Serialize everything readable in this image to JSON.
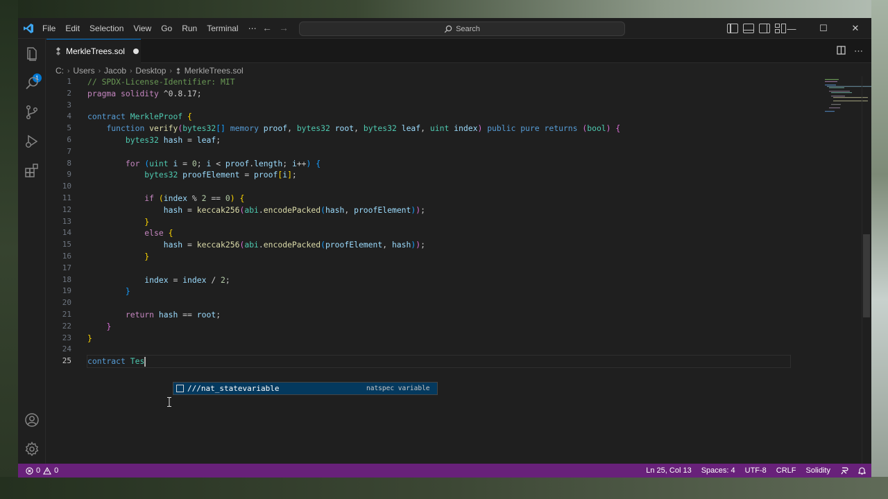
{
  "window": {
    "menu": [
      "File",
      "Edit",
      "Selection",
      "View",
      "Go",
      "Run",
      "Terminal",
      "⋯"
    ],
    "search_placeholder": "Search",
    "nav_back": "←",
    "nav_forward": "→",
    "controls": {
      "minimize": "—",
      "maximize": "☐",
      "close": "✕"
    }
  },
  "activity_bar": {
    "icons": [
      "explorer-icon",
      "search-icon",
      "source-control-icon",
      "run-debug-icon",
      "extensions-icon",
      "account-icon",
      "manage-gear-icon"
    ],
    "explorer_badge": "1"
  },
  "tab": {
    "label": "MerkleTrees.sol",
    "modified": true
  },
  "breadcrumb": [
    "C:",
    "Users",
    "Jacob",
    "Desktop",
    "MerkleTrees.sol"
  ],
  "editor": {
    "line_numbers": [
      "1",
      "2",
      "3",
      "4",
      "5",
      "6",
      "7",
      "8",
      "9",
      "10",
      "11",
      "12",
      "13",
      "14",
      "15",
      "16",
      "17",
      "18",
      "19",
      "20",
      "21",
      "22",
      "23",
      "24",
      "25"
    ],
    "active_line": "25",
    "lines": [
      [
        {
          "c": "cm",
          "t": "// SPDX-License-Identifier: MIT"
        }
      ],
      [
        {
          "c": "k",
          "t": "pragma"
        },
        {
          "c": "",
          "t": " "
        },
        {
          "c": "k",
          "t": "solidity"
        },
        {
          "c": "",
          "t": " ^0.8.17;"
        }
      ],
      [],
      [
        {
          "c": "kb",
          "t": "contract"
        },
        {
          "c": "",
          "t": " "
        },
        {
          "c": "t",
          "t": "MerkleProof"
        },
        {
          "c": "",
          "t": " "
        },
        {
          "c": "by",
          "t": "{"
        }
      ],
      [
        {
          "c": "",
          "t": "    "
        },
        {
          "c": "kb",
          "t": "function"
        },
        {
          "c": "",
          "t": " "
        },
        {
          "c": "fn",
          "t": "verify"
        },
        {
          "c": "bp",
          "t": "("
        },
        {
          "c": "t",
          "t": "bytes32"
        },
        {
          "c": "bb",
          "t": "[]"
        },
        {
          "c": "",
          "t": " "
        },
        {
          "c": "kb",
          "t": "memory"
        },
        {
          "c": "",
          "t": " "
        },
        {
          "c": "v",
          "t": "proof"
        },
        {
          "c": "",
          "t": ", "
        },
        {
          "c": "t",
          "t": "bytes32"
        },
        {
          "c": "",
          "t": " "
        },
        {
          "c": "v",
          "t": "root"
        },
        {
          "c": "",
          "t": ", "
        },
        {
          "c": "t",
          "t": "bytes32"
        },
        {
          "c": "",
          "t": " "
        },
        {
          "c": "v",
          "t": "leaf"
        },
        {
          "c": "",
          "t": ", "
        },
        {
          "c": "t",
          "t": "uint"
        },
        {
          "c": "",
          "t": " "
        },
        {
          "c": "v",
          "t": "index"
        },
        {
          "c": "bp",
          "t": ")"
        },
        {
          "c": "",
          "t": " "
        },
        {
          "c": "kb",
          "t": "public"
        },
        {
          "c": "",
          "t": " "
        },
        {
          "c": "kb",
          "t": "pure"
        },
        {
          "c": "",
          "t": " "
        },
        {
          "c": "kb",
          "t": "returns"
        },
        {
          "c": "",
          "t": " "
        },
        {
          "c": "bp",
          "t": "("
        },
        {
          "c": "t",
          "t": "bool"
        },
        {
          "c": "bp",
          "t": ")"
        },
        {
          "c": "",
          "t": " "
        },
        {
          "c": "bp",
          "t": "{"
        }
      ],
      [
        {
          "c": "",
          "t": "        "
        },
        {
          "c": "t",
          "t": "bytes32"
        },
        {
          "c": "",
          "t": " "
        },
        {
          "c": "v",
          "t": "hash"
        },
        {
          "c": "",
          "t": " = "
        },
        {
          "c": "v",
          "t": "leaf"
        },
        {
          "c": "",
          "t": ";"
        }
      ],
      [],
      [
        {
          "c": "",
          "t": "        "
        },
        {
          "c": "k",
          "t": "for"
        },
        {
          "c": "",
          "t": " "
        },
        {
          "c": "bb",
          "t": "("
        },
        {
          "c": "t",
          "t": "uint"
        },
        {
          "c": "",
          "t": " "
        },
        {
          "c": "v",
          "t": "i"
        },
        {
          "c": "",
          "t": " = "
        },
        {
          "c": "num",
          "t": "0"
        },
        {
          "c": "",
          "t": "; "
        },
        {
          "c": "v",
          "t": "i"
        },
        {
          "c": "",
          "t": " < "
        },
        {
          "c": "v",
          "t": "proof"
        },
        {
          "c": "",
          "t": "."
        },
        {
          "c": "v",
          "t": "length"
        },
        {
          "c": "",
          "t": "; "
        },
        {
          "c": "v",
          "t": "i"
        },
        {
          "c": "",
          "t": "++"
        },
        {
          "c": "bb",
          "t": ")"
        },
        {
          "c": "",
          "t": " "
        },
        {
          "c": "bb",
          "t": "{"
        }
      ],
      [
        {
          "c": "",
          "t": "            "
        },
        {
          "c": "t",
          "t": "bytes32"
        },
        {
          "c": "",
          "t": " "
        },
        {
          "c": "v",
          "t": "proofElement"
        },
        {
          "c": "",
          "t": " = "
        },
        {
          "c": "v",
          "t": "proof"
        },
        {
          "c": "by",
          "t": "["
        },
        {
          "c": "v",
          "t": "i"
        },
        {
          "c": "by",
          "t": "]"
        },
        {
          "c": "",
          "t": ";"
        }
      ],
      [],
      [
        {
          "c": "",
          "t": "            "
        },
        {
          "c": "k",
          "t": "if"
        },
        {
          "c": "",
          "t": " "
        },
        {
          "c": "by",
          "t": "("
        },
        {
          "c": "v",
          "t": "index"
        },
        {
          "c": "",
          "t": " % "
        },
        {
          "c": "num",
          "t": "2"
        },
        {
          "c": "",
          "t": " == "
        },
        {
          "c": "num",
          "t": "0"
        },
        {
          "c": "by",
          "t": ")"
        },
        {
          "c": "",
          "t": " "
        },
        {
          "c": "by",
          "t": "{"
        }
      ],
      [
        {
          "c": "",
          "t": "                "
        },
        {
          "c": "v",
          "t": "hash"
        },
        {
          "c": "",
          "t": " = "
        },
        {
          "c": "fn",
          "t": "keccak256"
        },
        {
          "c": "bp",
          "t": "("
        },
        {
          "c": "t",
          "t": "abi"
        },
        {
          "c": "",
          "t": "."
        },
        {
          "c": "fn",
          "t": "encodePacked"
        },
        {
          "c": "bb",
          "t": "("
        },
        {
          "c": "v",
          "t": "hash"
        },
        {
          "c": "",
          "t": ", "
        },
        {
          "c": "v",
          "t": "proofElement"
        },
        {
          "c": "bb",
          "t": ")"
        },
        {
          "c": "bp",
          "t": ")"
        },
        {
          "c": "",
          "t": ";"
        }
      ],
      [
        {
          "c": "",
          "t": "            "
        },
        {
          "c": "by",
          "t": "}"
        }
      ],
      [
        {
          "c": "",
          "t": "            "
        },
        {
          "c": "k",
          "t": "else"
        },
        {
          "c": "",
          "t": " "
        },
        {
          "c": "by",
          "t": "{"
        }
      ],
      [
        {
          "c": "",
          "t": "                "
        },
        {
          "c": "v",
          "t": "hash"
        },
        {
          "c": "",
          "t": " = "
        },
        {
          "c": "fn",
          "t": "keccak256"
        },
        {
          "c": "bp",
          "t": "("
        },
        {
          "c": "t",
          "t": "abi"
        },
        {
          "c": "",
          "t": "."
        },
        {
          "c": "fn",
          "t": "encodePacked"
        },
        {
          "c": "bb",
          "t": "("
        },
        {
          "c": "v",
          "t": "proofElement"
        },
        {
          "c": "",
          "t": ", "
        },
        {
          "c": "v",
          "t": "hash"
        },
        {
          "c": "bb",
          "t": ")"
        },
        {
          "c": "bp",
          "t": ")"
        },
        {
          "c": "",
          "t": ";"
        }
      ],
      [
        {
          "c": "",
          "t": "            "
        },
        {
          "c": "by",
          "t": "}"
        }
      ],
      [],
      [
        {
          "c": "",
          "t": "            "
        },
        {
          "c": "v",
          "t": "index"
        },
        {
          "c": "",
          "t": " = "
        },
        {
          "c": "v",
          "t": "index"
        },
        {
          "c": "",
          "t": " / "
        },
        {
          "c": "num",
          "t": "2"
        },
        {
          "c": "",
          "t": ";"
        }
      ],
      [
        {
          "c": "",
          "t": "        "
        },
        {
          "c": "bb",
          "t": "}"
        }
      ],
      [],
      [
        {
          "c": "",
          "t": "        "
        },
        {
          "c": "k",
          "t": "return"
        },
        {
          "c": "",
          "t": " "
        },
        {
          "c": "v",
          "t": "hash"
        },
        {
          "c": "",
          "t": " == "
        },
        {
          "c": "v",
          "t": "root"
        },
        {
          "c": "",
          "t": ";"
        }
      ],
      [
        {
          "c": "",
          "t": "    "
        },
        {
          "c": "bp",
          "t": "}"
        }
      ],
      [
        {
          "c": "by",
          "t": "}"
        }
      ],
      [],
      [
        {
          "c": "kb",
          "t": "contract"
        },
        {
          "c": "",
          "t": " "
        },
        {
          "c": "t",
          "t": "Tes"
        }
      ]
    ]
  },
  "suggestion": {
    "label": "///nat_statevariable",
    "detail": "natspec variable"
  },
  "status_bar": {
    "errors": "0",
    "warnings": "0",
    "position": "Ln 25, Col 13",
    "indent": "Spaces: 4",
    "encoding": "UTF-8",
    "eol": "CRLF",
    "language": "Solidity",
    "colors": {
      "background": "#68217a"
    }
  }
}
